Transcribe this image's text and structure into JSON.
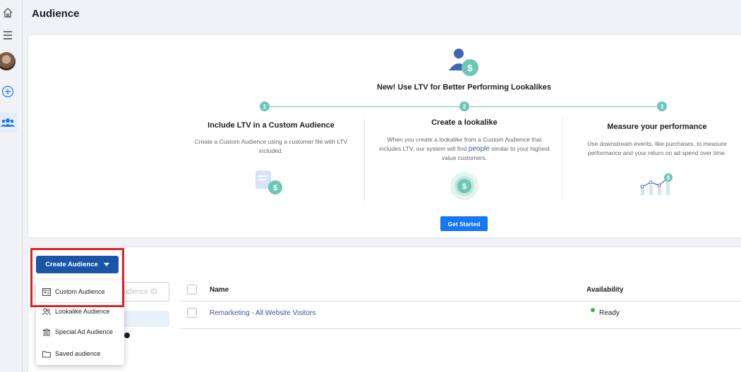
{
  "header": {
    "title": "Audience"
  },
  "rail": {
    "items": [
      {
        "icon": "home-icon"
      },
      {
        "icon": "menu-icon"
      },
      {
        "icon": "avatar"
      },
      {
        "icon": "plus-circle-icon"
      },
      {
        "icon": "audience-people-icon",
        "active": true
      }
    ]
  },
  "promo": {
    "headline": "New! Use LTV for Better Performing Lookalikes",
    "steps": [
      "1",
      "2",
      "3"
    ],
    "columns": [
      {
        "title": "Include LTV in a Custom Audience",
        "desc": "Create a Custom Audience using a customer file with LTV included."
      },
      {
        "title": "Create a lookalike",
        "desc_a": "When you create a lookalike from a Custom Audience that includes LTV, our system will find ",
        "desc_hl": "people",
        "desc_b": " similar to your highest value customers."
      },
      {
        "title": "Measure your performance",
        "desc": "Use downstream events, like purchases, to measure performance and your return on ad spend over time."
      }
    ],
    "cta": "Get Started",
    "accent": "#6cc7b6"
  },
  "toolbar": {
    "create_label": "Create Audience",
    "search_placeholder": "udience ID"
  },
  "menu": {
    "items": [
      {
        "label": "Custom Audience",
        "icon": "custom-audience-icon"
      },
      {
        "label": "Lookalike Audience",
        "icon": "lookalike-people-icon"
      },
      {
        "label": "Special Ad Audience",
        "icon": "institution-icon"
      },
      {
        "label": "Saved audience",
        "icon": "folder-icon"
      }
    ]
  },
  "table": {
    "columns": [
      "Name",
      "Availability"
    ],
    "rows": [
      {
        "name": "Remarketing - All Website Visitors",
        "availability": "Ready"
      }
    ]
  },
  "colors": {
    "primary": "#1b55a8",
    "highlight": "#d9242a",
    "link": "#385898",
    "ready": "#42b72a"
  }
}
